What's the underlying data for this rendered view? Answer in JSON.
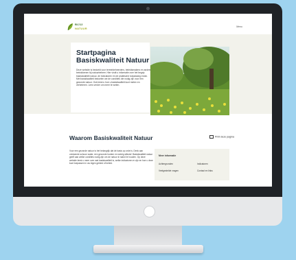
{
  "site": {
    "logo_line1": "BIJ12",
    "logo_line2": "NATUUR",
    "menu_label": "Menu"
  },
  "hero": {
    "title": "Startpagina Basiskwaliteit Natuur",
    "body": "Deze website is bedoeld voor terreinbeheerders, beleidsmakers en andere betrokkenen bij natuurbeheer. Hier vindt u informatie over het begrip basiskwaliteit natuur, de indicatoren en de praktische toepassing ervan. Met basiskwaliteit bedoelen we de condities die nodig zijn voor een gezonde natuur. Ook leest u hoe u basiskwaliteit kunt meten en verbeteren. Lees verder om meer te weten."
  },
  "section": {
    "title": "Waarom Basiskwaliteit Natuur",
    "print_label": "Print deze pagina",
    "body": "Voor een gezonde natuur is het belangrijk dat de basis op orde is. Denk aan voldoende schoon water, een gezonde bodem en weinig stikstof. Basiskwaliteit natuur geeft aan welke condities nodig zijn om de natuur in stand te houden. Op deze website leest u meer over wat basiskwaliteit is, welke indicatoren er zijn en hoe u deze kunt toepassen in uw eigen gebied of beleid."
  },
  "info": {
    "heading": "Meer informatie",
    "items": [
      "Achtergronden",
      "Indicatoren",
      "Veelgestelde vragen",
      "Contact en links"
    ]
  }
}
